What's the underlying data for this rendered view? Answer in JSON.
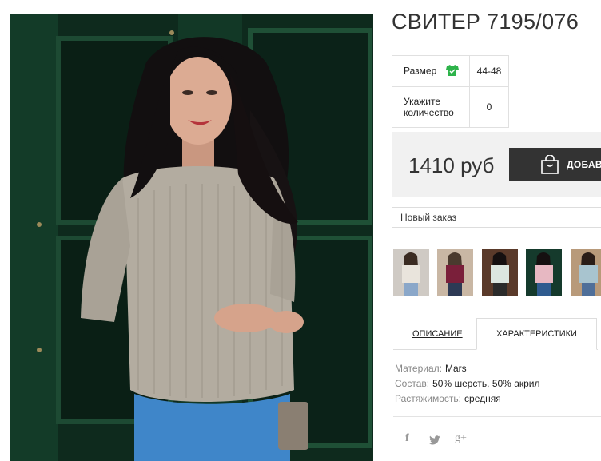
{
  "product": {
    "title": "СВИТЕР 7195/076",
    "options": [
      {
        "label": "Размер",
        "value": "44-48",
        "icon": "tshirt-icon"
      },
      {
        "label": "Укажите количество",
        "value": "0"
      }
    ],
    "price": "1410 руб",
    "add_button_label": "ДОБАВИТЬ",
    "select_value": "Новый заказ"
  },
  "thumbnails": [
    {
      "name": "white-sweater-thumbnail",
      "top": "#e9e4dc",
      "bottom": "#8aa7c9",
      "bg": "#cfcac4"
    },
    {
      "name": "burgundy-sweater-thumbnail",
      "top": "#7a1f3a",
      "bottom": "#2d3a55",
      "bg": "#c9b7a4"
    },
    {
      "name": "mint-sweater-thumbnail",
      "top": "#dce6df",
      "bottom": "#2b2b2b",
      "bg": "#5a3a2a"
    },
    {
      "name": "pink-sweater-thumbnail",
      "top": "#e7b8c2",
      "bottom": "#2f5b8f",
      "bg": "#153a2c"
    },
    {
      "name": "blue-sweater-thumbnail",
      "top": "#a8c4cf",
      "bottom": "#4f6f99",
      "bg": "#b89a7a"
    }
  ],
  "tabs": {
    "description": "ОПИСАНИЕ",
    "characteristics": "ХАРАКТЕРИСТИКИ"
  },
  "specs": [
    {
      "key": "Материал:",
      "value": "Mars"
    },
    {
      "key": "Состав:",
      "value": "50% шерсть, 50% акрил"
    },
    {
      "key": "Растяжимость:",
      "value": "средняя"
    }
  ],
  "social": [
    "f",
    "twitter-icon",
    "g+"
  ],
  "colors": {
    "accent_green": "#2db34a",
    "button_dark": "#333333",
    "price_bg": "#f1f1f1"
  }
}
